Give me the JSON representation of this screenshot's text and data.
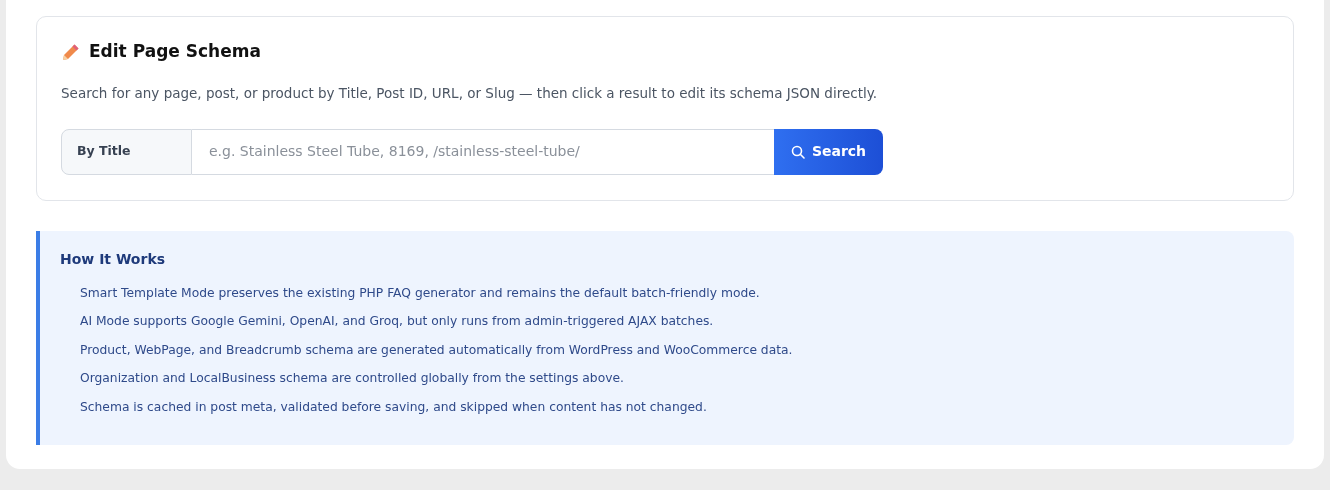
{
  "editor": {
    "title": "Edit Page Schema",
    "description": "Search for any page, post, or product by Title, Post ID, URL, or Slug — then click a result to edit its schema JSON directly.",
    "search": {
      "mode": "By Title",
      "placeholder": "e.g. Stainless Steel Tube, 8169, /stainless-steel-tube/",
      "button": "Search"
    }
  },
  "how_it_works": {
    "title": "How It Works",
    "items": [
      "Smart Template Mode preserves the existing PHP FAQ generator and remains the default batch-friendly mode.",
      "AI Mode supports Google Gemini, OpenAI, and Groq, but only runs from admin-triggered AJAX batches.",
      "Product, WebPage, and Breadcrumb schema are generated automatically from WordPress and WooCommerce data.",
      "Organization and LocalBusiness schema are controlled globally from the settings above.",
      "Schema is cached in post meta, validated before saving, and skipped when content has not changed."
    ]
  }
}
